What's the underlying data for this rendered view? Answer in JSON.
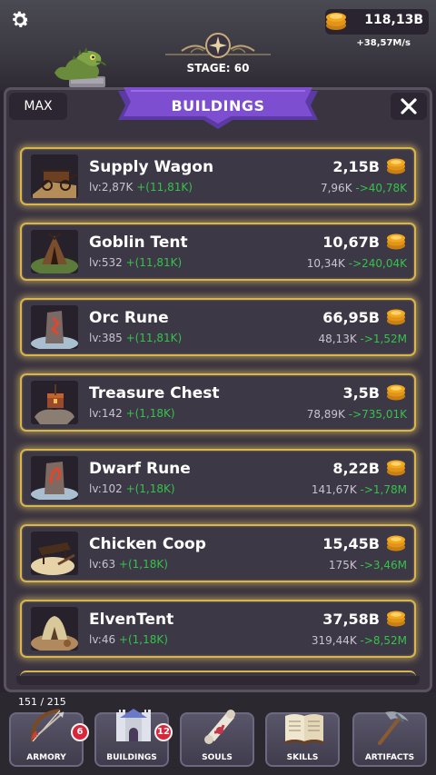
{
  "hud": {
    "gold": "118,13B",
    "gold_rate": "+38,57M/s",
    "stage": "STAGE: 60",
    "settings_icon": "gear-icon"
  },
  "panel": {
    "title": "BUILDINGS",
    "max_label": "MAX",
    "close_icon": "close-icon"
  },
  "buildings": [
    {
      "name": "Supply Wagon",
      "level": "lv:2,87K",
      "bonus": "+(11,81K)",
      "cost": "2,15B",
      "income": "7,96K",
      "next_income": "->40,78K"
    },
    {
      "name": "Goblin Tent",
      "level": "lv:532",
      "bonus": "+(11,81K)",
      "cost": "10,67B",
      "income": "10,34K",
      "next_income": "->240,04K"
    },
    {
      "name": "Orc Rune",
      "level": "lv:385",
      "bonus": "+(11,81K)",
      "cost": "66,95B",
      "income": "48,13K",
      "next_income": "->1,52M"
    },
    {
      "name": "Treasure Chest",
      "level": "lv:142",
      "bonus": "+(1,18K)",
      "cost": "3,5B",
      "income": "78,89K",
      "next_income": "->735,01K"
    },
    {
      "name": "Dwarf Rune",
      "level": "lv:102",
      "bonus": "+(1,18K)",
      "cost": "8,22B",
      "income": "141,67K",
      "next_income": "->1,78M"
    },
    {
      "name": "Chicken Coop",
      "level": "lv:63",
      "bonus": "+(1,18K)",
      "cost": "15,45B",
      "income": "175K",
      "next_income": "->3,46M"
    },
    {
      "name": "ElvenTent",
      "level": "lv:46",
      "bonus": "+(1,18K)",
      "cost": "37,58B",
      "income": "319,44K",
      "next_income": "->8,52M"
    }
  ],
  "footer": {
    "capacity": "151 / 215"
  },
  "nav": [
    {
      "label": "ARMORY",
      "badge": "6",
      "icon": "bow-icon"
    },
    {
      "label": "BUILDINGS",
      "badge": "12",
      "icon": "castle-icon"
    },
    {
      "label": "SOULS",
      "badge": "",
      "icon": "scroll-icon"
    },
    {
      "label": "SKILLS",
      "badge": "",
      "icon": "book-icon"
    },
    {
      "label": "ARTIFACTS",
      "badge": "",
      "icon": "pickaxe-icon"
    }
  ],
  "colors": {
    "card_border": "#d8b64a",
    "ribbon": "#7d4fd0",
    "bonus_green": "#35c24a",
    "badge_red": "#d8263a",
    "coin_gold": "#f2a81c"
  }
}
